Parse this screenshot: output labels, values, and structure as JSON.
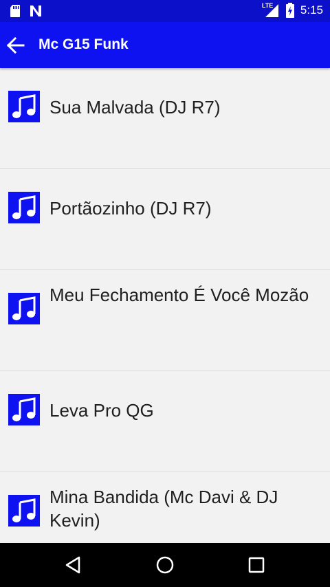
{
  "status_bar": {
    "time": "5:15",
    "network": "LTE",
    "icons": [
      "sd-card-icon",
      "n-notification-icon",
      "signal-icon",
      "battery-charging-icon"
    ]
  },
  "app_bar": {
    "title": "Mc G15 Funk",
    "back_icon": "arrow-left-icon"
  },
  "songs": [
    {
      "title": "Sua Malvada (DJ R7)"
    },
    {
      "title": "Portãozinho (DJ R7)"
    },
    {
      "title": "Meu Fechamento É Você Mozão"
    },
    {
      "title": "Leva Pro QG"
    },
    {
      "title": "Mina Bandida (Mc Davi & DJ Kevin)"
    }
  ],
  "nav_bar": {
    "icons": [
      "back-triangle-icon",
      "home-circle-icon",
      "recents-square-icon"
    ]
  },
  "colors": {
    "status_bar": "#0d10c9",
    "app_bar": "#0f12f0",
    "list_background": "#f2f2f2",
    "song_icon": "#0f12f0"
  }
}
